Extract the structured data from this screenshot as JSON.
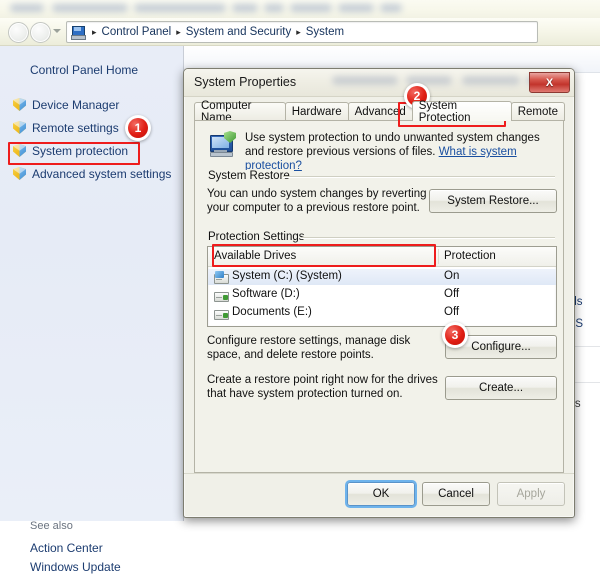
{
  "explorer": {
    "address": {
      "crumbs": [
        "Control Panel",
        "System and Security",
        "System"
      ],
      "separator": "▸",
      "computer_icon": "computer-icon",
      "back_icon": "back-arrow-icon",
      "forward_icon": "forward-arrow-icon",
      "history_icon": "chevron-down-icon"
    },
    "sidebar": {
      "home_label": "Control Panel Home",
      "items": [
        {
          "label": "Device Manager",
          "icon": "shield-icon"
        },
        {
          "label": "Remote settings",
          "icon": "shield-icon"
        },
        {
          "label": "System protection",
          "icon": "shield-icon"
        },
        {
          "label": "Advanced system settings",
          "icon": "shield-icon"
        }
      ],
      "see_also_label": "See also",
      "see_also_links": [
        "Action Center",
        "Windows Update"
      ]
    },
    "background_fragments": {
      "frag1": "eds",
      "frag2": "or S",
      "frag3": "Dis"
    }
  },
  "dialog": {
    "title": "System Properties",
    "close_label": "X",
    "tabs": [
      {
        "label": "Computer Name",
        "active": false
      },
      {
        "label": "Hardware",
        "active": false
      },
      {
        "label": "Advanced",
        "active": false
      },
      {
        "label": "System Protection",
        "active": true
      },
      {
        "label": "Remote",
        "active": false
      }
    ],
    "intro": {
      "icon": "system-protection-icon",
      "text": "Use system protection to undo unwanted system changes and restore previous versions of files.",
      "link": "What is system protection?"
    },
    "system_restore": {
      "group_label": "System Restore",
      "text": "You can undo system changes by reverting your computer to a previous restore point.",
      "button": "System Restore..."
    },
    "protection_settings": {
      "group_label": "Protection Settings",
      "columns": [
        "Available Drives",
        "Protection"
      ],
      "rows": [
        {
          "drive": "System (C:) (System)",
          "protection": "On",
          "selected": true,
          "icon": "system-drive-icon"
        },
        {
          "drive": "Software (D:)",
          "protection": "Off",
          "selected": false,
          "icon": "drive-icon"
        },
        {
          "drive": "Documents (E:)",
          "protection": "Off",
          "selected": false,
          "icon": "drive-icon"
        }
      ],
      "configure_text": "Configure restore settings, manage disk space, and delete restore points.",
      "configure_button": "Configure...",
      "create_text": "Create a restore point right now for the drives that have system protection turned on.",
      "create_button": "Create..."
    },
    "footer": {
      "ok": "OK",
      "cancel": "Cancel",
      "apply": "Apply"
    }
  },
  "annotations": {
    "badges": [
      {
        "number": "1"
      },
      {
        "number": "2"
      },
      {
        "number": "3"
      }
    ],
    "highlight_color": "#ee1c1c",
    "badge_color": "#e01d13"
  }
}
